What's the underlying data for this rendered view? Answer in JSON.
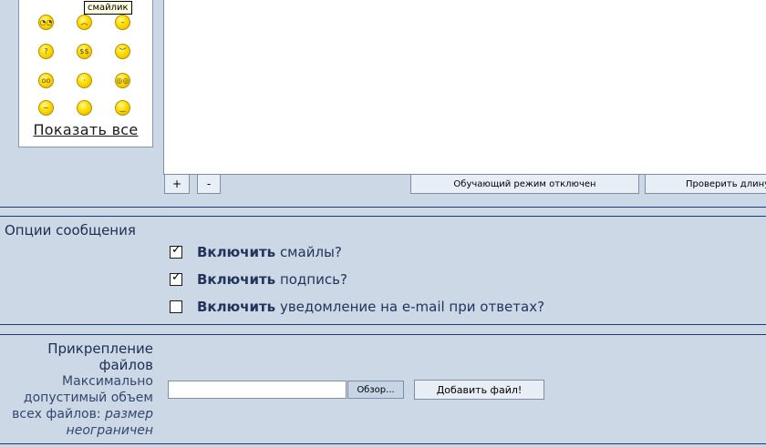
{
  "smileys": {
    "tooltip": "смайлик",
    "show_all": "Показать все",
    "items": [
      {
        "name": "cool",
        "face": "◔◔"
      },
      {
        "name": "sad",
        "face": "︵"
      },
      {
        "name": "neutral",
        "face": "–"
      },
      {
        "name": "thinking",
        "face": "?"
      },
      {
        "name": "money",
        "face": "$$"
      },
      {
        "name": "angry",
        "face": "︶"
      },
      {
        "name": "glasses",
        "face": "oo"
      },
      {
        "name": "confused",
        "face": "·"
      },
      {
        "name": "eyes",
        "face": "◎◎"
      },
      {
        "name": "wink",
        "face": "~"
      },
      {
        "name": "blank",
        "face": ""
      },
      {
        "name": "smile",
        "face": "‿"
      }
    ],
    "color": "#ffd800"
  },
  "editor": {
    "text": ""
  },
  "toolbar": {
    "plus": "+",
    "minus": "-",
    "training_mode": "Обучающий режим отключен",
    "check_length": "Проверить длину"
  },
  "options": {
    "title": "Опции сообщения",
    "items": [
      {
        "strong": "Включить",
        "rest": " смайлы?",
        "checked": true
      },
      {
        "strong": "Включить",
        "rest": " подпись?",
        "checked": true
      },
      {
        "strong": "Включить",
        "rest": " уведомление на e-mail при ответах?",
        "checked": false
      }
    ]
  },
  "attachments": {
    "title_line1": "Прикрепление",
    "title_line2": "файлов",
    "desc_line1": "Максимально",
    "desc_line2": "допустимый объем",
    "desc_line3_prefix": "всех файлов: ",
    "desc_line3_em": "размер",
    "desc_line4_em": "неограничен",
    "file_value": "",
    "browse": "Обзор...",
    "add_file": "Добавить файл!"
  },
  "colors": {
    "background": "#ccd8e6",
    "separator": "#1f3a73",
    "label": "#1e2d52"
  }
}
